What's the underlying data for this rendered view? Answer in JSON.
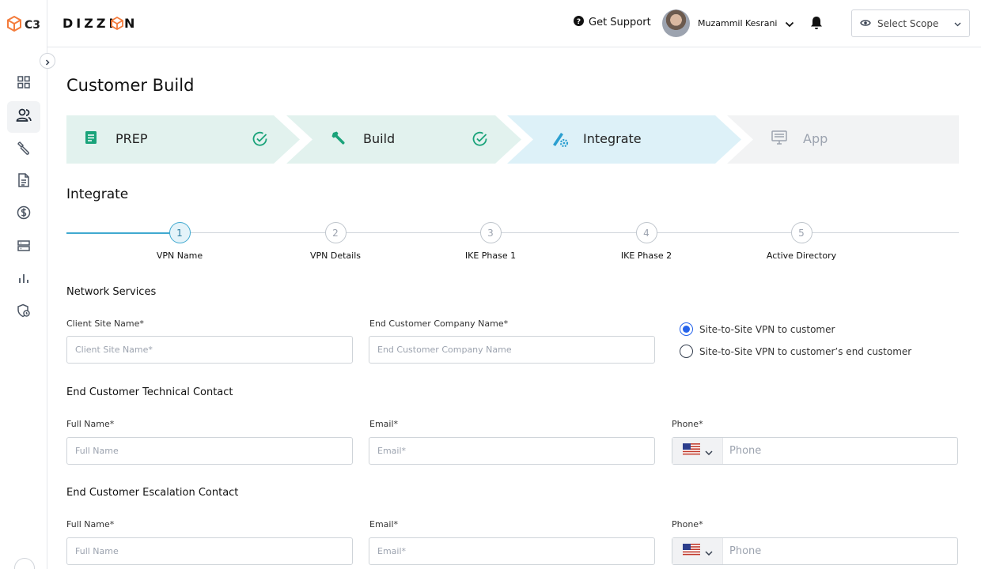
{
  "app": {
    "logo_text": "C3",
    "brand_name": "DIZZI N",
    "brand_icon": "cube-icon",
    "accent_color": "#f47c3c"
  },
  "sidebar": {
    "items": [
      {
        "name": "dashboard",
        "icon": "grid-icon",
        "active": false
      },
      {
        "name": "customers",
        "icon": "users-icon",
        "active": true
      },
      {
        "name": "tools",
        "icon": "wrench-icon",
        "active": false
      },
      {
        "name": "documents",
        "icon": "document-icon",
        "active": false
      },
      {
        "name": "billing",
        "icon": "dollar-icon",
        "active": false
      },
      {
        "name": "servers",
        "icon": "server-icon",
        "active": false
      },
      {
        "name": "reports",
        "icon": "bar-chart-icon",
        "active": false
      },
      {
        "name": "history",
        "icon": "clock-shield-icon",
        "active": false
      }
    ]
  },
  "header": {
    "support_label": "Get Support",
    "user_name": "Muzammil Kesrani",
    "scope_label": "Select Scope"
  },
  "page": {
    "title": "Customer Build"
  },
  "stages": [
    {
      "label": "PREP",
      "icon": "document-icon",
      "status": "complete",
      "color": "#e2f2ee"
    },
    {
      "label": "Build",
      "icon": "wrench-icon",
      "status": "complete",
      "color": "#e2f2ee"
    },
    {
      "label": "Integrate",
      "icon": "gear-pen-icon",
      "status": "active",
      "color": "#ddf1f8"
    },
    {
      "label": "App",
      "icon": "monitor-icon",
      "status": "pending",
      "color": "#f2f3f4"
    }
  ],
  "integrate": {
    "title": "Integrate",
    "substeps": [
      {
        "num": "1",
        "label": "VPN Name",
        "active": true
      },
      {
        "num": "2",
        "label": "VPN Details",
        "active": false
      },
      {
        "num": "3",
        "label": "IKE Phase 1",
        "active": false
      },
      {
        "num": "4",
        "label": "IKE Phase 2",
        "active": false
      },
      {
        "num": "5",
        "label": "Active Directory",
        "active": false
      }
    ]
  },
  "network": {
    "title": "Network Services",
    "client_site": {
      "label": "Client Site Name*",
      "placeholder": "Client Site Name*",
      "value": ""
    },
    "end_company": {
      "label": "End Customer Company Name*",
      "placeholder": "End Customer Company Name",
      "value": ""
    },
    "vpn_options": [
      {
        "label": "Site-to-Site VPN to customer",
        "checked": true
      },
      {
        "label": "Site-to-Site VPN to customer’s end customer",
        "checked": false
      }
    ]
  },
  "technical": {
    "title": "End Customer Technical Contact",
    "full_name": {
      "label": "Full Name*",
      "placeholder": "Full Name"
    },
    "email": {
      "label": "Email*",
      "placeholder": "Email*"
    },
    "phone": {
      "label": "Phone*",
      "placeholder": "Phone",
      "country": "US"
    }
  },
  "escalation": {
    "title": "End Customer Escalation Contact",
    "full_name": {
      "label": "Full Name*",
      "placeholder": "Full Name"
    },
    "email": {
      "label": "Email*",
      "placeholder": "Email*"
    },
    "phone": {
      "label": "Phone*",
      "placeholder": "Phone",
      "country": "US"
    }
  }
}
